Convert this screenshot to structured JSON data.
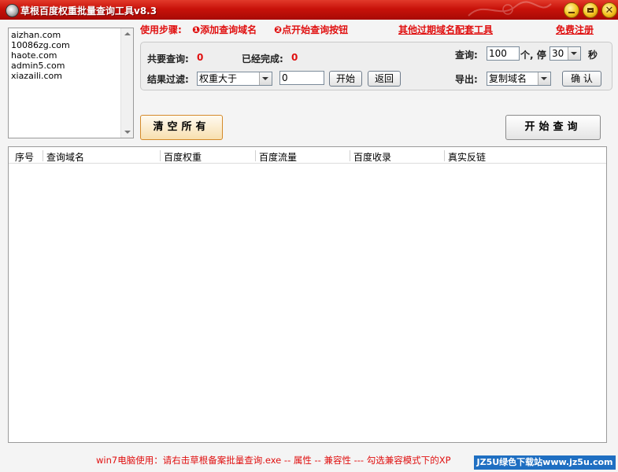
{
  "window": {
    "title": "草根百度权重批量查询工具v8.3",
    "controls": {
      "minimize": "minimize",
      "maximize": "maximize",
      "close": "✕"
    }
  },
  "domains": [
    "aizhan.com",
    "10086zg.com",
    "haote.com",
    "admin5.com",
    "xiazaili.com"
  ],
  "steps": {
    "label": "使用步骤:",
    "step1": "❶添加查询域名",
    "step2": "❷点开始查询按钮",
    "expired_tools_link": "其他过期域名配套工具",
    "register_link": "免费注册"
  },
  "stats": {
    "total_label": "共要查询:",
    "total_value": "0",
    "done_label": "已经完成:",
    "done_value": "0"
  },
  "filter": {
    "label": "结果过滤:",
    "condition_selected": "权重大于",
    "threshold_value": "0",
    "start_button": "开始",
    "back_button": "返回"
  },
  "query_settings": {
    "label": "查询:",
    "count_value": "100",
    "count_unit": "个, 停",
    "pause_selected": "30",
    "pause_unit": "秒"
  },
  "export": {
    "label": "导出:",
    "selected": "复制域名",
    "confirm_button": "确 认"
  },
  "actions": {
    "clear_all": "清空所有",
    "start_query": "开始查询"
  },
  "table": {
    "columns": [
      "序号",
      "查询域名",
      "百度权重",
      "百度流量",
      "百度收录",
      "真实反链"
    ],
    "rows": []
  },
  "footer": {
    "note": "win7电脑使用：请右击草根备案批量查询.exe -- 属性 -- 兼容性 --- 勾选兼容模式下的XP",
    "watermark": "JZ5U绿色下载站www.jz5u.com"
  },
  "colors": {
    "titlebar": "#c8120a",
    "accent_red": "#e01010",
    "watermark_bg": "#1f6fc2"
  }
}
